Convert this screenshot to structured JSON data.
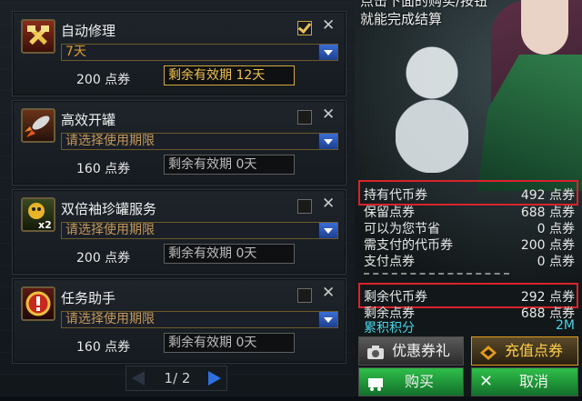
{
  "items": [
    {
      "name": "自动修理",
      "selected": "7天",
      "price": "200 点券",
      "remaining": "剩余有效期 12天",
      "checked": true,
      "highlight": true
    },
    {
      "name": "高效开罐",
      "selected": "请选择使用期限",
      "price": "160 点券",
      "remaining": "剩余有效期 0天",
      "checked": false,
      "highlight": false
    },
    {
      "name": "双倍袖珍罐服务",
      "selected": "请选择使用期限",
      "price": "200 点券",
      "remaining": "剩余有效期 0天",
      "checked": false,
      "highlight": false
    },
    {
      "name": "任务助手",
      "selected": "请选择使用期限",
      "price": "160 点券",
      "remaining": "剩余有效期 0天",
      "checked": false,
      "highlight": false
    }
  ],
  "icon_badges": {
    "double": "x2"
  },
  "pager": {
    "text": "1/ 2"
  },
  "message": {
    "line1": "点击下面的购买/按钮",
    "line2": "就能完成结算"
  },
  "stats": [
    {
      "label": "持有代币券",
      "value": "492 点券"
    },
    {
      "label": "保留点券",
      "value": "688 点券"
    },
    {
      "label": "可以为您节省",
      "value": "0 点券"
    },
    {
      "label": "需支付的代币券",
      "value": "200 点券"
    },
    {
      "label": "支付点券",
      "value": "0 点券"
    },
    {
      "label": "剩余代币券",
      "value": "292 点券"
    },
    {
      "label": "剩余点券",
      "value": "688 点券"
    },
    {
      "label": "累积积分",
      "value": "2M"
    }
  ],
  "buttons": {
    "coupon_gift": "优惠券礼盒",
    "recharge": "充值点券",
    "buy": "购买",
    "cancel": "取消"
  },
  "colors": {
    "highlight_box": "#d9232b",
    "accent_gold": "#e0a030",
    "points_cyan": "#48d4e8",
    "buy_green": "#1f9a3a",
    "cancel_green": "#1f9a3a",
    "recharge_orange": "#e39b1b"
  }
}
